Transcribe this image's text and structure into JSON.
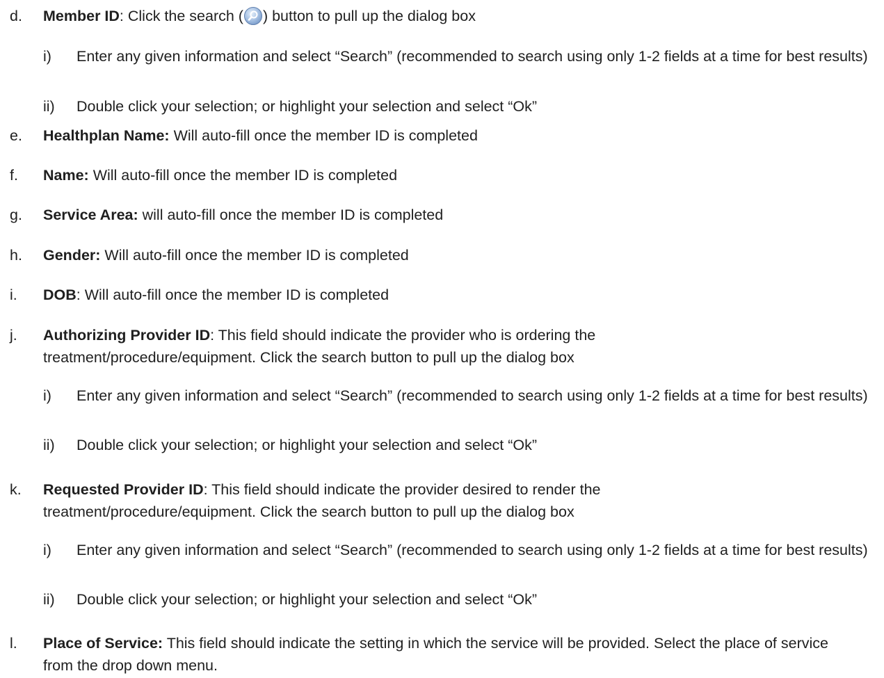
{
  "items": [
    {
      "marker": "d.",
      "bold": "Member ID",
      "pre_icon": ": Click the search (",
      "icon": "search-icon",
      "post_icon": ") button to pull up the dialog box",
      "sub": [
        {
          "marker": "i)",
          "text": "Enter any given information and select “Search” (recommended to search using only 1-2 fields at a time for best results)"
        },
        {
          "marker": "ii)",
          "text": "Double click your selection; or highlight your selection and select “Ok”"
        }
      ]
    },
    {
      "marker": "e.",
      "bold": "Healthplan Name:",
      "text": " Will auto-fill once the member ID is completed"
    },
    {
      "marker": "f.",
      "bold": "Name:",
      "text": " Will auto-fill once the member ID is completed"
    },
    {
      "marker": "g.",
      "bold": "Service Area:",
      "text": " will auto-fill once the member ID is completed"
    },
    {
      "marker": "h.",
      "bold": "Gender:",
      "text": " Will auto-fill once the member ID is completed"
    },
    {
      "marker": "i.",
      "bold": "DOB",
      "text": ": Will auto-fill once the member ID is completed"
    },
    {
      "marker": "j.",
      "bold": "Authorizing Provider ID",
      "text": ": This field should indicate the provider who is ordering the treatment/procedure/equipment. Click the search button to pull up the dialog box",
      "sub": [
        {
          "marker": "i)",
          "text": "Enter any given information and select “Search” (recommended to search using only 1-2 fields at a time for best results)"
        },
        {
          "marker": "ii)",
          "text": "Double click your selection; or highlight your selection and select “Ok”"
        }
      ]
    },
    {
      "marker": "k.",
      "bold": "Requested Provider ID",
      "text": ": This field should indicate the provider desired to render the treatment/procedure/equipment. Click the search button to pull up the dialog box",
      "sub": [
        {
          "marker": "i)",
          "text": "Enter any given information and select “Search” (recommended to search using only 1-2 fields at a time for best results)"
        },
        {
          "marker": "ii)",
          "text": "Double click your selection; or highlight your selection and select “Ok”"
        }
      ]
    },
    {
      "marker": "l.",
      "bold": "Place of Service:",
      "text": " This field should indicate the setting in which the service will be provided. Select the place of service from the drop down menu."
    }
  ]
}
